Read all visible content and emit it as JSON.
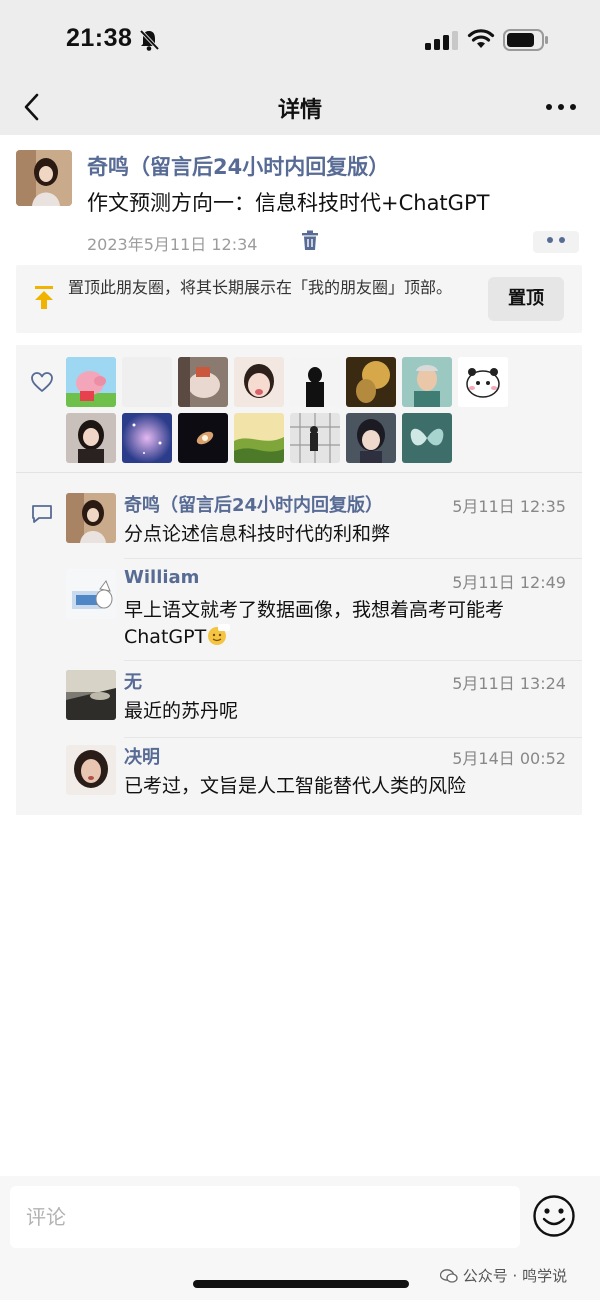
{
  "status_bar": {
    "time": "21:38"
  },
  "nav": {
    "title": "详情"
  },
  "post": {
    "author": "奇鸣（留言后24小时内回复版）",
    "text": "作文预测方向一：信息科技时代+ChatGPT",
    "date": "2023年5月11日 12:34"
  },
  "pin": {
    "text": "置顶此朋友圈，将其长期展示在「我的朋友圈」顶部。",
    "button_label": "置顶"
  },
  "comments": [
    {
      "name": "奇鸣（留言后24小时内回复版）",
      "time": "5月11日 12:35",
      "text": "分点论述信息科技时代的利和弊"
    },
    {
      "name": "William",
      "time": "5月11日 12:49",
      "text": "早上语文就考了数据画像，我想着高考可能考ChatGPT"
    },
    {
      "name": "无",
      "time": "5月11日 13:24",
      "text": "最近的苏丹呢"
    },
    {
      "name": "决明",
      "time": "5月14日 00:52",
      "text": "已考过，文旨是人工智能替代人类的风险"
    }
  ],
  "footer": {
    "comment_placeholder": "评论",
    "watermark": "公众号 · 鸣学说"
  },
  "colors": {
    "link_blue": "#576b95",
    "background_gray": "#ededed",
    "panel_gray": "#f5f5f5"
  },
  "icons": [
    "bell-slash-icon",
    "signal-icon",
    "wifi-icon",
    "battery-icon",
    "back-chevron-icon",
    "more-icon",
    "trash-icon",
    "pin-top-icon",
    "heart-icon",
    "comment-icon",
    "emoji-icon"
  ]
}
